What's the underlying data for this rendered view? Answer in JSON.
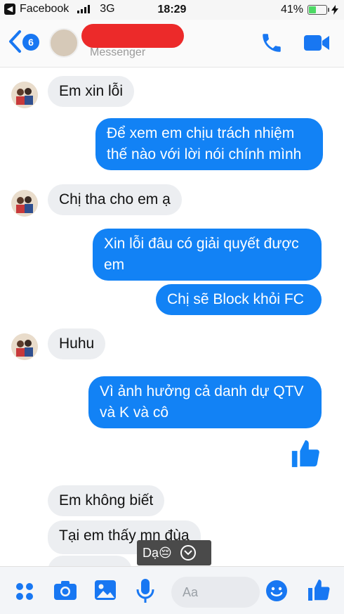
{
  "status_bar": {
    "back_app": "Facebook",
    "carrier": "3G",
    "time": "18:29",
    "battery": "41%",
    "battery_level": 0.41
  },
  "header": {
    "back_count": "6",
    "subtitle": "Messenger"
  },
  "messages": [
    {
      "side": "in",
      "text": "Em xin lỗi"
    },
    {
      "side": "out",
      "text": "Để xem em chịu trách nhiệm\nthế nào với lời nói chính mình"
    },
    {
      "side": "in",
      "text": "Chị tha cho em ạ"
    },
    {
      "side": "out",
      "text": "Xin lỗi đâu có giải quyết được\nem"
    },
    {
      "side": "out",
      "text": "Chị sẽ Block khỏi FC"
    },
    {
      "side": "in",
      "text": "Huhu"
    },
    {
      "side": "out",
      "text": "Vì ảnh hưởng cả danh dự QTV\nvà K và cô"
    },
    {
      "side": "in",
      "text": "Em không biết"
    },
    {
      "side": "in",
      "text": "Tại em thấy mn đùa"
    }
  ],
  "reply_chip": {
    "text": "Dạ😔"
  },
  "composer": {
    "placeholder": "Aa"
  },
  "colors": {
    "accent": "#1282f5",
    "incoming": "#eceef1",
    "redaction": "#ec2a2a"
  }
}
